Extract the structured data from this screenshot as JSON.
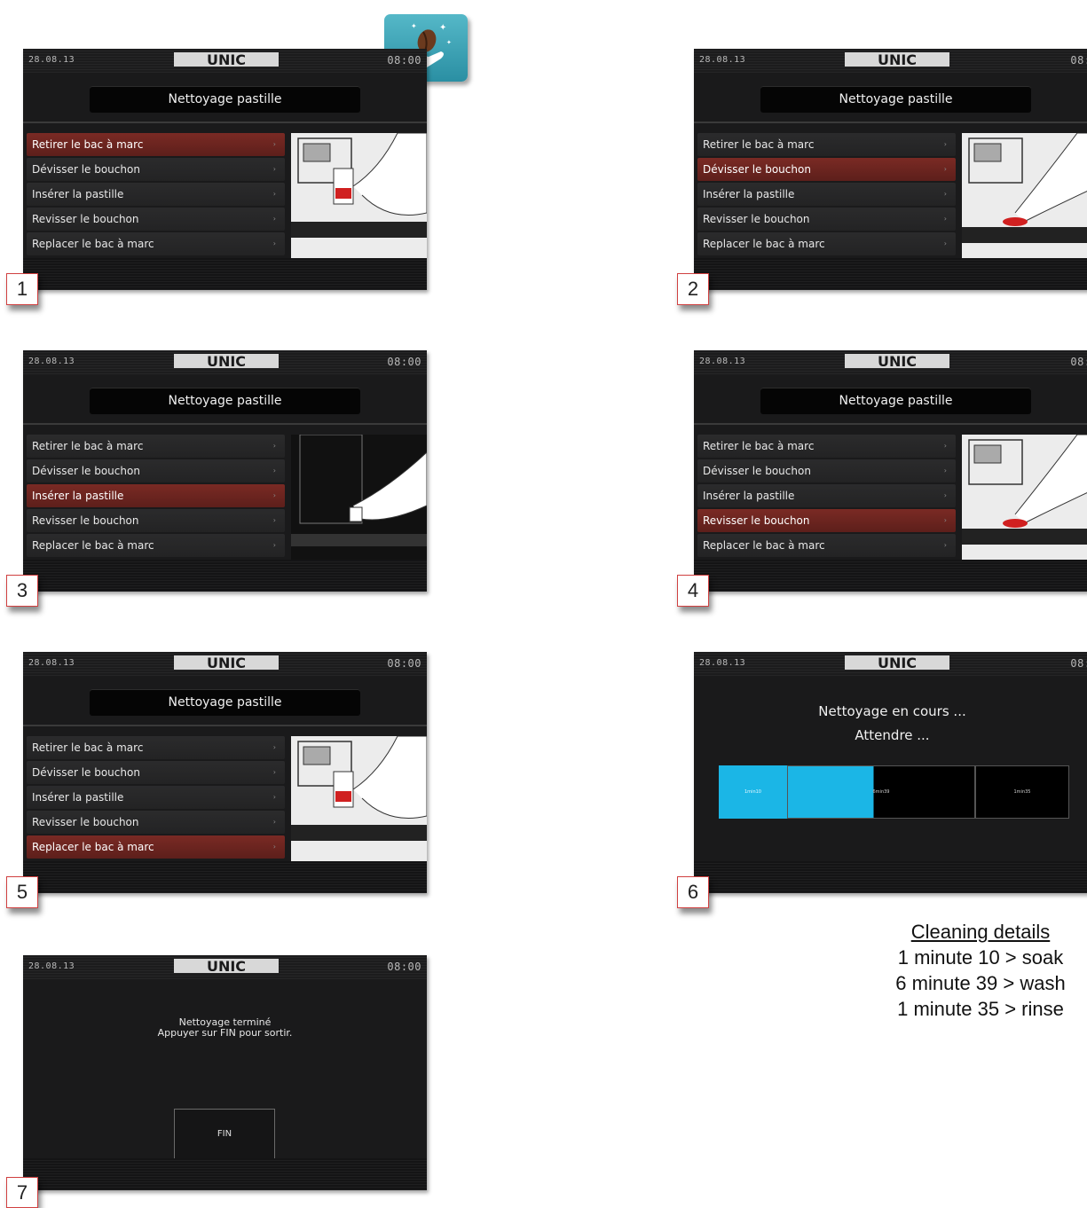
{
  "header": {
    "date": "28.08.13",
    "time": "08:00",
    "brand": "UNIC"
  },
  "screen_title": "Nettoyage pastille",
  "menu": [
    "Retirer le bac à marc",
    "Dévisser le bouchon",
    "Insérer la pastille",
    "Revisser le bouchon",
    "Replacer le bac à marc"
  ],
  "steps": {
    "s1": "1",
    "s2": "2",
    "s3": "3",
    "s4": "4",
    "s5": "5",
    "s6": "6",
    "s7": "7"
  },
  "progress": {
    "line1": "Nettoyage en cours ...",
    "line2": "Attendre ...",
    "seg1": "1min10",
    "seg2": "6min39",
    "seg3": "1min35"
  },
  "finish": {
    "line1": "Nettoyage terminé",
    "line2": "Appuyer sur FIN pour sortir.",
    "button": "FIN"
  },
  "details": {
    "heading": "Cleaning details",
    "l1": "1 minute 10 > soak",
    "l2": "6 minute 39 > wash",
    "l3": "1 minute 35 > rinse"
  },
  "colors": {
    "active": "#6e2520",
    "accent": "#1bb6e6",
    "badge": "#3aa0b3"
  }
}
